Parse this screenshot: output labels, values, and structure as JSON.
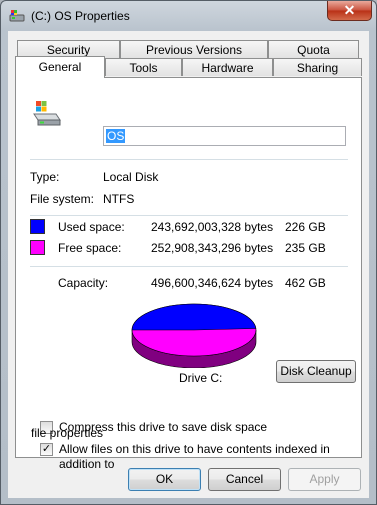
{
  "window": {
    "title": "(C:) OS Properties",
    "close_glyph": "✕"
  },
  "tabs": {
    "row1": [
      "Security",
      "Previous Versions",
      "Quota"
    ],
    "row2": [
      "General",
      "Tools",
      "Hardware",
      "Sharing"
    ],
    "active": "General"
  },
  "general": {
    "drive_name": "OS",
    "type_label": "Type:",
    "type_value": "Local Disk",
    "fs_label": "File system:",
    "fs_value": "NTFS",
    "used_label": "Used space:",
    "used_bytes": "243,692,003,328 bytes",
    "used_gb": "226 GB",
    "free_label": "Free space:",
    "free_bytes": "252,908,343,296 bytes",
    "free_gb": "235 GB",
    "capacity_label": "Capacity:",
    "capacity_bytes": "496,600,346,624 bytes",
    "capacity_gb": "462 GB",
    "drive_label": "Drive C:",
    "disk_cleanup": "Disk Cleanup",
    "compress_label": "Compress this drive to save disk space",
    "compress_checked": false,
    "index_label_1": "Allow files on this drive to have contents indexed in addition to",
    "index_label_2": "file properties",
    "index_checked": true,
    "check_glyph": "✓"
  },
  "colors": {
    "used": "#0000ff",
    "free": "#ff00ff",
    "used_side": "#000080",
    "free_side": "#800080"
  },
  "pie": {
    "used_fraction": 0.4907,
    "free_fraction": 0.5093
  },
  "buttons": {
    "ok": "OK",
    "cancel": "Cancel",
    "apply": "Apply"
  },
  "icons": {
    "title": "drive-icon",
    "drive": "hard-drive-icon"
  }
}
